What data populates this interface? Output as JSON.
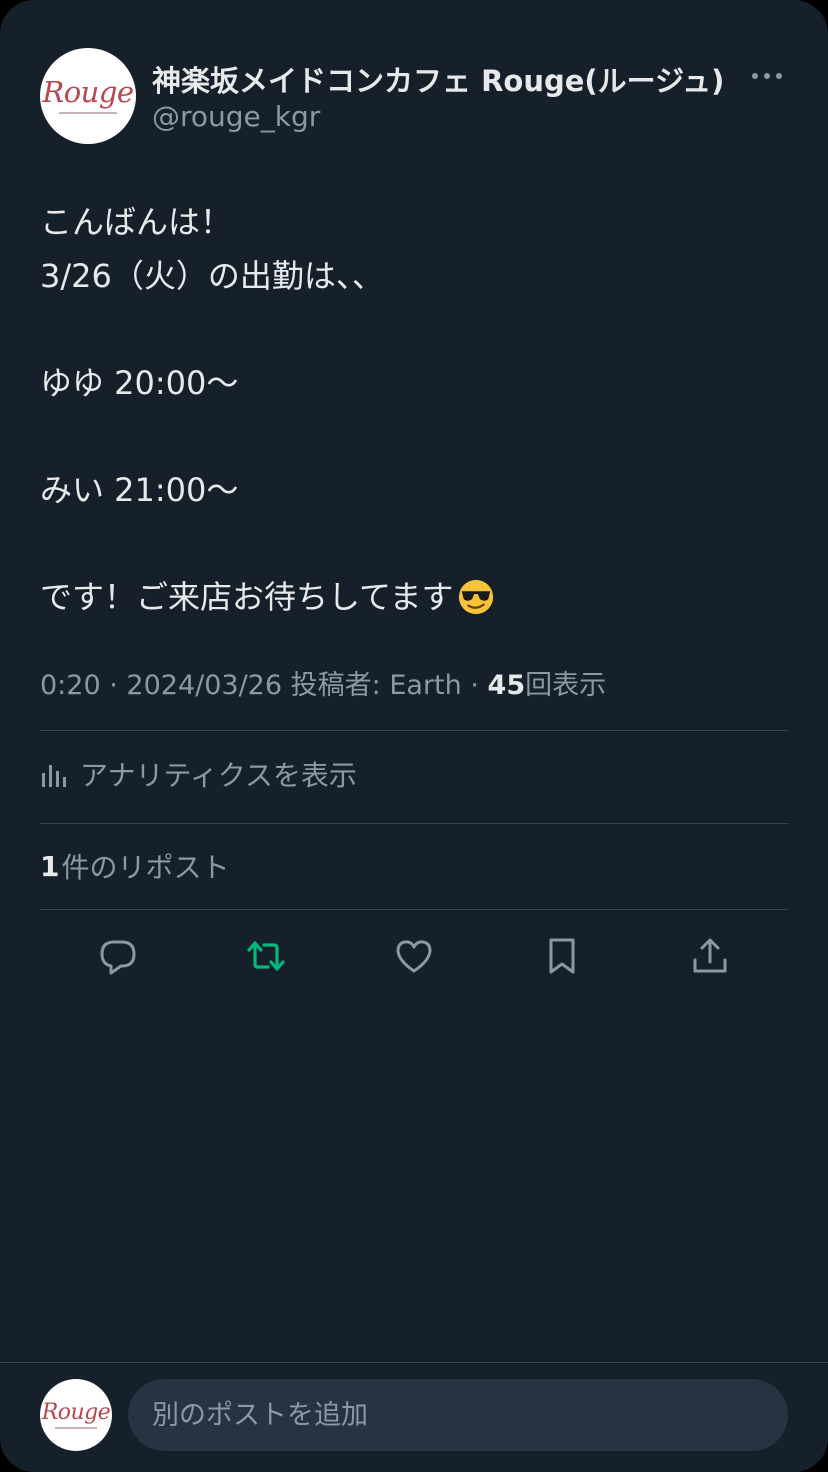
{
  "account": {
    "display_name": "神楽坂メイドコンカフェ Rouge(ルージュ)",
    "handle": "@rouge_kgr",
    "avatar_text": "Rouge"
  },
  "post": {
    "lines": [
      "こんばんは！",
      "3/26（火）の出勤は、、",
      "",
      "ゆゆ 20:00～",
      "",
      "みい 21:00～",
      "",
      "です！ご来店お待ちしてます"
    ],
    "emoji": "smiling-face-with-sunglasses"
  },
  "meta": {
    "time": "0:20",
    "separator": "·",
    "date": "2024/03/26",
    "posted_by_label": "投稿者:",
    "posted_by": "Earth",
    "views_count": "45",
    "views_label": "回表示"
  },
  "analytics": {
    "label": "アナリティクスを表示",
    "icon": "analytics-icon"
  },
  "reposts": {
    "count": "1",
    "label": "件のリポスト"
  },
  "actions": [
    {
      "name": "reply",
      "icon": "reply-icon"
    },
    {
      "name": "repost",
      "icon": "repost-icon",
      "active": true
    },
    {
      "name": "like",
      "icon": "heart-icon"
    },
    {
      "name": "bookmark",
      "icon": "bookmark-icon"
    },
    {
      "name": "share",
      "icon": "share-icon"
    }
  ],
  "reply_bar": {
    "placeholder": "別のポストを追加"
  },
  "colors": {
    "background": "#15202b",
    "text_primary": "#e7e9ea",
    "text_secondary": "#8b98a5",
    "divider": "#38444d",
    "repost_active": "#00ba7c",
    "input_bg": "#273340",
    "avatar_logo": "#b8474e"
  }
}
